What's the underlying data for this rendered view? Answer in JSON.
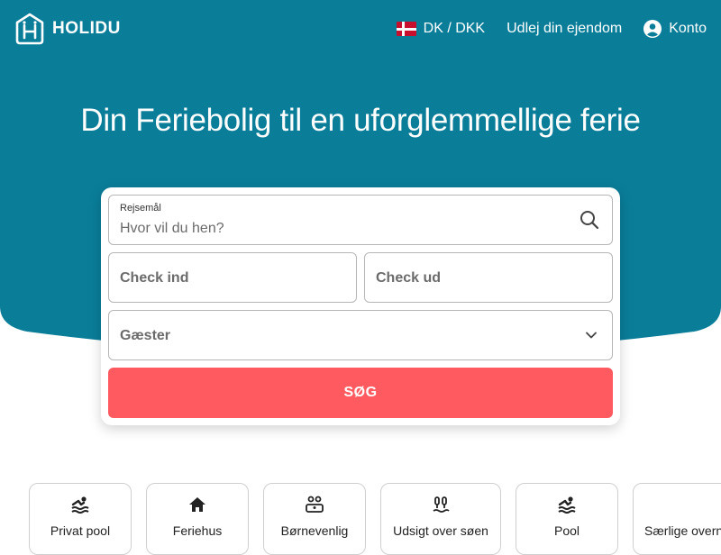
{
  "header": {
    "logo_text": "HOLIDU",
    "locale_label": "DK / DKK",
    "list_property_label": "Udlej din ejendom",
    "account_label": "Konto"
  },
  "hero": {
    "headline": "Din Feriebolig til en uforglemmellige ferie"
  },
  "search": {
    "destination_label": "Rejsemål",
    "destination_placeholder": "Hvor vil du hen?",
    "checkin_placeholder": "Check ind",
    "checkout_placeholder": "Check ud",
    "guests_placeholder": "Gæster",
    "submit_label": "SØG"
  },
  "categories": [
    {
      "label": "Privat pool",
      "icon": "swimmer-icon"
    },
    {
      "label": "Feriehus",
      "icon": "house-icon"
    },
    {
      "label": "Børnevenlig",
      "icon": "family-icon"
    },
    {
      "label": "Udsigt over søen",
      "icon": "lake-view-icon"
    },
    {
      "label": "Pool",
      "icon": "swimmer-icon"
    },
    {
      "label": "Særlige overnatninger",
      "icon": "special-stay-icon"
    }
  ],
  "colors": {
    "brand_teal": "#0a7d99",
    "cta_coral": "#ff5a5f"
  }
}
